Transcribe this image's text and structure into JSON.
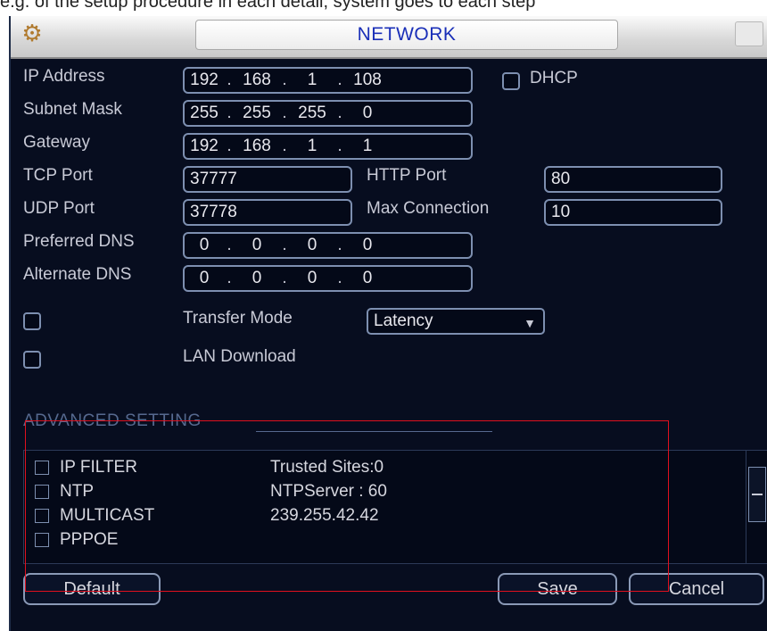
{
  "top_strip": {
    "caption": "e.g. of the setup procedure in each detail, system goes to each step"
  },
  "window": {
    "title": "NETWORK"
  },
  "fields": {
    "ip_address": {
      "label": "IP Address",
      "octets": [
        "192",
        "168",
        "1",
        "108"
      ]
    },
    "subnet_mask": {
      "label": "Subnet Mask",
      "octets": [
        "255",
        "255",
        "255",
        "0"
      ]
    },
    "gateway": {
      "label": "Gateway",
      "octets": [
        "192",
        "168",
        "1",
        "1"
      ]
    },
    "dhcp": {
      "label": "DHCP",
      "checked": false
    },
    "tcp_port": {
      "label": "TCP Port",
      "value": "37777"
    },
    "http_port": {
      "label": "HTTP Port",
      "value": "80"
    },
    "udp_port": {
      "label": "UDP Port",
      "value": "37778"
    },
    "max_connection": {
      "label": "Max Connection",
      "value": "10"
    },
    "preferred_dns": {
      "label": "Preferred DNS",
      "octets": [
        "0",
        "0",
        "0",
        "0"
      ]
    },
    "alternate_dns": {
      "label": "Alternate DNS",
      "octets": [
        "0",
        "0",
        "0",
        "0"
      ]
    },
    "transfer_mode": {
      "label": "Transfer Mode",
      "value": "Latency",
      "checked": false
    },
    "lan_download": {
      "label": "LAN Download",
      "checked": false
    }
  },
  "advanced": {
    "heading": "ADVANCED SETTING",
    "rows": [
      {
        "name": "IP FILTER",
        "value": "Trusted Sites:0"
      },
      {
        "name": "NTP",
        "value": "NTPServer : 60"
      },
      {
        "name": "MULTICAST",
        "value": "239.255.42.42"
      },
      {
        "name": "PPPOE",
        "value": ""
      }
    ]
  },
  "buttons": {
    "default": "Default",
    "save": "Save",
    "cancel": "Cancel"
  },
  "colors": {
    "background": "#070d1f",
    "title_text": "#1a2fb8",
    "field_border": "#7d8fb0",
    "label_text": "#c8cad6",
    "highlight_box": "#e0101e"
  }
}
